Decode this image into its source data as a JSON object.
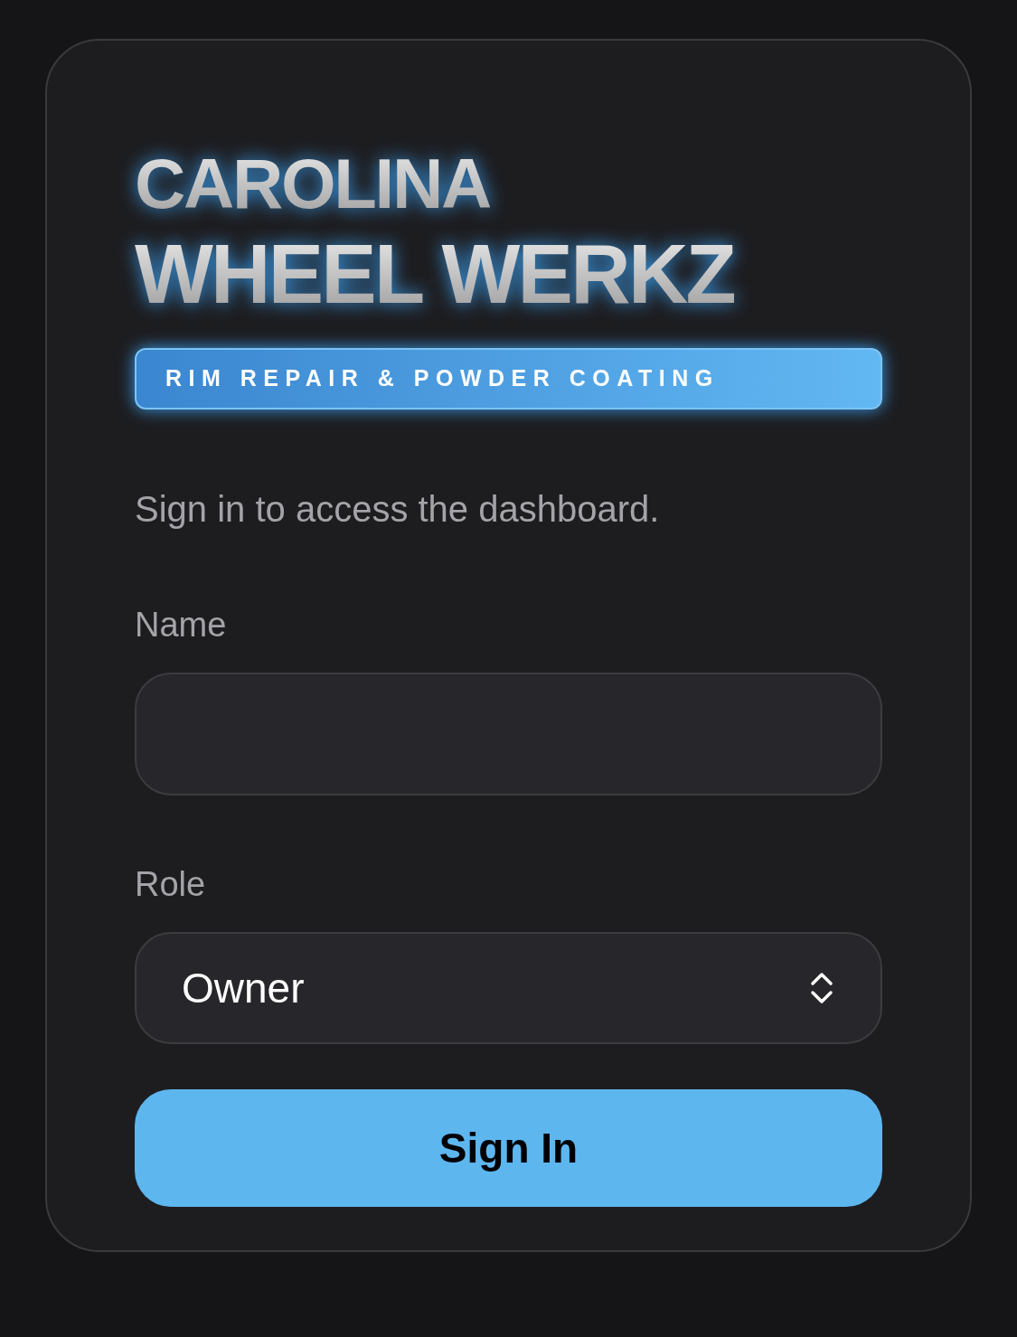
{
  "logo": {
    "lines": [
      "CAROLINA",
      "WHEEL WERKZ"
    ],
    "tagline": "RIM REPAIR & POWDER COATING"
  },
  "subtitle": "Sign in to access the dashboard.",
  "fields": [
    {
      "kind": "text",
      "label": "Name"
    },
    {
      "kind": "select",
      "label": "Role",
      "value": "Owner"
    }
  ],
  "button": "Sign In"
}
